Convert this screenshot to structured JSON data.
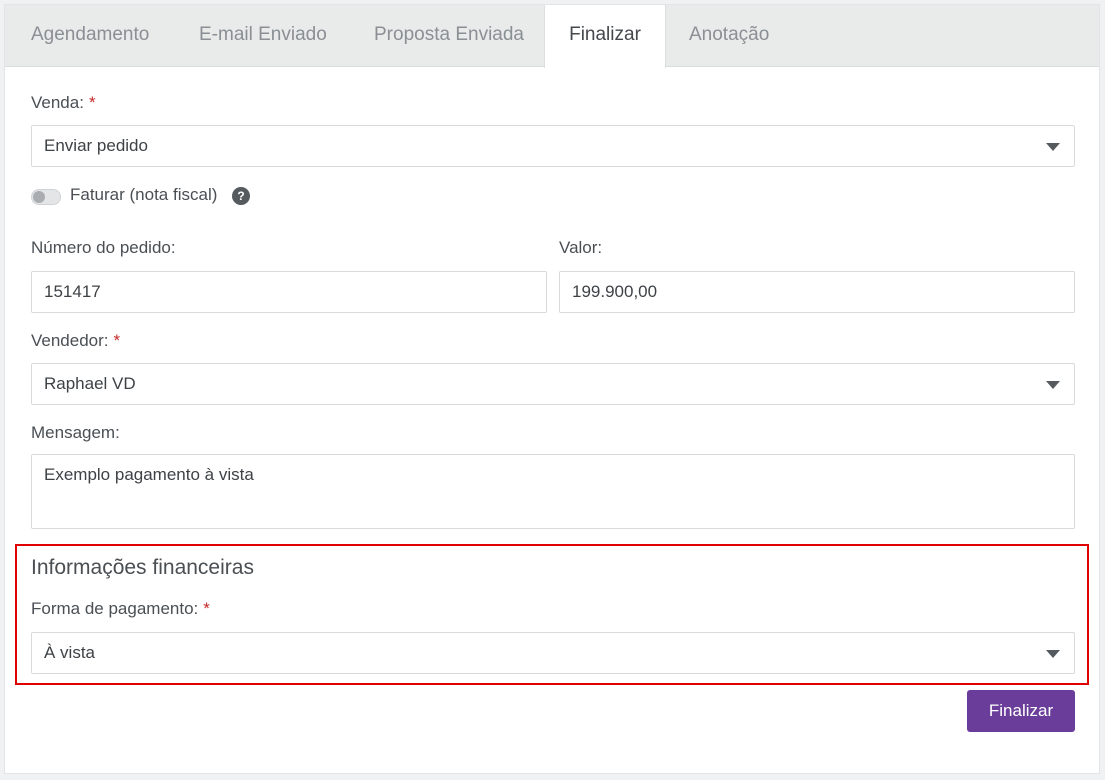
{
  "tabs": [
    {
      "label": "Agendamento",
      "active": false
    },
    {
      "label": "E-mail Enviado",
      "active": false
    },
    {
      "label": "Proposta Enviada",
      "active": false
    },
    {
      "label": "Finalizar",
      "active": true
    },
    {
      "label": "Anotação",
      "active": false
    }
  ],
  "form": {
    "venda": {
      "label": "Venda:",
      "required_mark": "*",
      "value": "Enviar pedido"
    },
    "faturar": {
      "label": "Faturar (nota fiscal)",
      "help_glyph": "?",
      "checked": false
    },
    "numero_pedido": {
      "label": "Número do pedido:",
      "value": "151417"
    },
    "valor": {
      "label": "Valor:",
      "value": "199.900,00"
    },
    "vendedor": {
      "label": "Vendedor:",
      "required_mark": "*",
      "value": "Raphael VD"
    },
    "mensagem": {
      "label": "Mensagem:",
      "value": "Exemplo pagamento à vista"
    }
  },
  "financeiro": {
    "title": "Informações financeiras",
    "forma_pagamento": {
      "label": "Forma de pagamento:",
      "required_mark": "*",
      "value": "À vista"
    }
  },
  "actions": {
    "finalizar_label": "Finalizar"
  },
  "colors": {
    "primary": "#6a3d9a",
    "highlight": "#e00000",
    "required": "#c62828",
    "tab_bar": "#e9ebeb"
  }
}
